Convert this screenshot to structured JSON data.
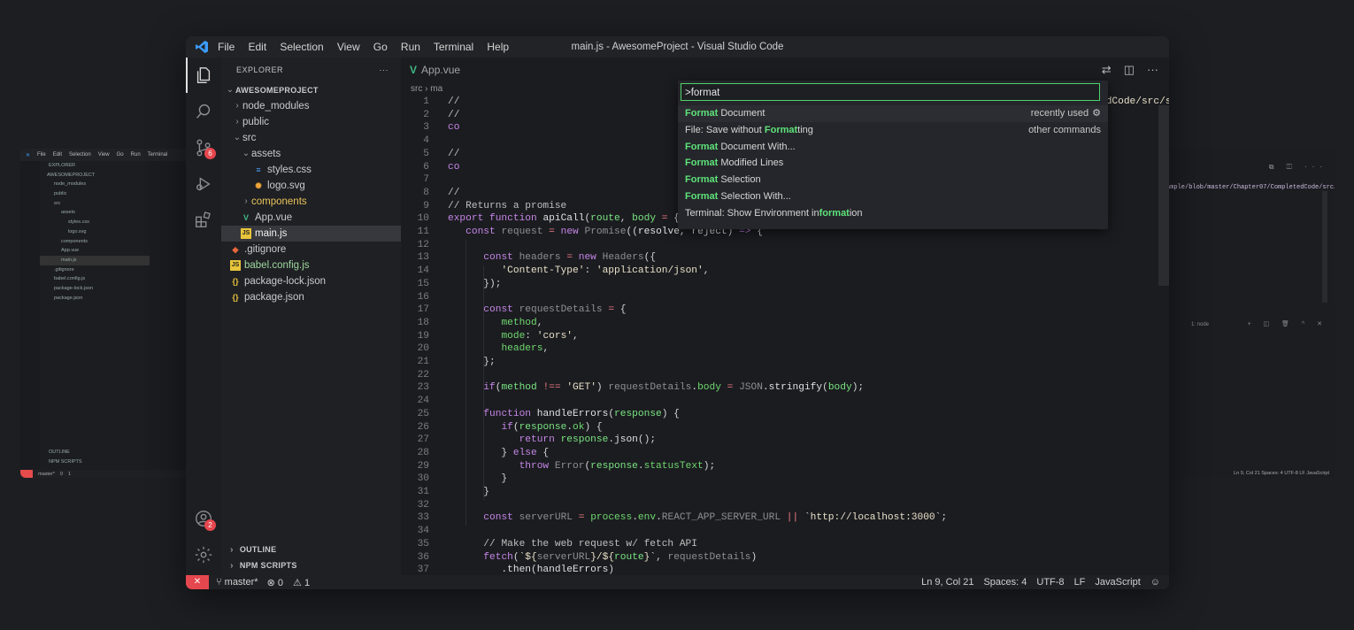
{
  "app": {
    "title": "main.js - AwesomeProject - Visual Studio Code",
    "menu": [
      "File",
      "Edit",
      "Selection",
      "View",
      "Go",
      "Run",
      "Terminal",
      "Help"
    ]
  },
  "activity_badges": {
    "source_control": "6",
    "accounts": "2"
  },
  "explorer": {
    "heading": "EXPLORER",
    "more": "···",
    "project": "AWESOMEPROJECT",
    "tree": [
      {
        "label": "node_modules",
        "kind": "folder",
        "open": false
      },
      {
        "label": "public",
        "kind": "folder",
        "open": false
      },
      {
        "label": "src",
        "kind": "folder",
        "open": true
      },
      {
        "label": "assets",
        "kind": "folder",
        "open": true
      },
      {
        "label": "styles.css",
        "kind": "css"
      },
      {
        "label": "logo.svg",
        "kind": "svg"
      },
      {
        "label": "components",
        "kind": "folder",
        "open": false
      },
      {
        "label": "App.vue",
        "kind": "vue"
      },
      {
        "label": "main.js",
        "kind": "js"
      },
      {
        "label": ".gitignore",
        "kind": "git"
      },
      {
        "label": "babel.config.js",
        "kind": "js"
      },
      {
        "label": "package-lock.json",
        "kind": "json"
      },
      {
        "label": "package.json",
        "kind": "json"
      }
    ],
    "outline": "OUTLINE",
    "npm_scripts": "NPM SCRIPTS"
  },
  "editor": {
    "tabs": [
      "App.vue",
      "ma"
    ],
    "breadcrumb": "src",
    "visible_url_fragment": "ample/blob/master/Chapter07/CompletedCode/src/se",
    "line_numbers": [
      "1",
      "2",
      "3",
      "4",
      "5",
      "6",
      "7",
      "8",
      "9",
      "10",
      "11",
      "12",
      "13",
      "14",
      "15",
      "16",
      "17",
      "18",
      "19",
      "20",
      "21",
      "22",
      "23",
      "24",
      "25",
      "26",
      "27",
      "28",
      "29",
      "30",
      "31",
      "32",
      "33",
      "34",
      "35",
      "36",
      "37"
    ],
    "code_line_9": "// Returns a promise",
    "code_line_36_comment": "// Make the web request w/ fetch API"
  },
  "command_palette": {
    "input_value": ">format",
    "items": [
      {
        "match": "Format",
        "rest": " Document",
        "prefix": "",
        "suffix": "",
        "right": "recently used"
      },
      {
        "prefix": "File: Save without ",
        "match": "Format",
        "rest": "ting",
        "suffix": "",
        "right": "other commands"
      },
      {
        "match": "Format",
        "rest": " Document With...",
        "prefix": "",
        "suffix": "",
        "right": ""
      },
      {
        "match": "Format",
        "rest": " Modified Lines",
        "prefix": "",
        "suffix": "",
        "right": ""
      },
      {
        "match": "Format",
        "rest": " Selection",
        "prefix": "",
        "suffix": "",
        "right": ""
      },
      {
        "match": "Format",
        "rest": " Selection With...",
        "prefix": "",
        "suffix": "",
        "right": ""
      },
      {
        "prefix": "Terminal: Show Environment in",
        "match": "format",
        "rest": "ion",
        "suffix": "",
        "right": ""
      }
    ]
  },
  "status": {
    "branch": "master*",
    "errors": "0",
    "warnings": "1",
    "position": "Ln 9, Col 21",
    "spaces": "Spaces: 4",
    "encoding": "UTF-8",
    "eol": "LF",
    "language": "JavaScript"
  },
  "background_windows": {
    "terminal_label": "1: node",
    "left_status_branch": "master*",
    "right_status": "Ln 9, Col 21   Spaces: 4   UTF-8   LF   JavaScript",
    "url_fragment": "ample/blob/master/Chapter07/CompletedCode/src/se"
  },
  "colors": {
    "accent_green": "#4fd26b",
    "badge_red": "#e5474e",
    "background": "#1d1e22"
  }
}
